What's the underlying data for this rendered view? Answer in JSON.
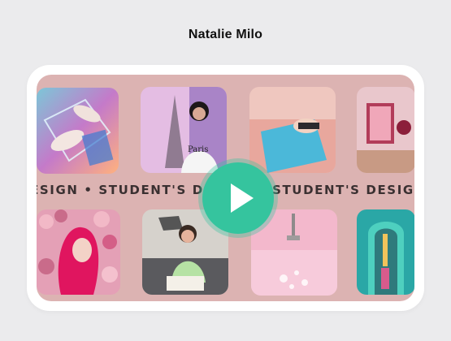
{
  "header": {
    "author_name": "Natalie Milo"
  },
  "video": {
    "marquee_text": "DESIGN • STUDENT'S DESIGN • STUDENT'S DESIGN • STUDENT'S DESIGN • STUDENT'S DESIGN",
    "play_icon": "play-icon",
    "accent_color": "#35c49e",
    "background_color": "#dcb3b2",
    "thumbnails": [
      {
        "name": "sneakers-thumbnail"
      },
      {
        "name": "paris-portrait-thumbnail"
      },
      {
        "name": "pool-thumbnail"
      },
      {
        "name": "pink-room-thumbnail"
      },
      {
        "name": "flower-wall-thumbnail"
      },
      {
        "name": "sofa-reading-thumbnail"
      },
      {
        "name": "pink-bath-thumbnail"
      },
      {
        "name": "teal-doorway-thumbnail"
      }
    ]
  }
}
